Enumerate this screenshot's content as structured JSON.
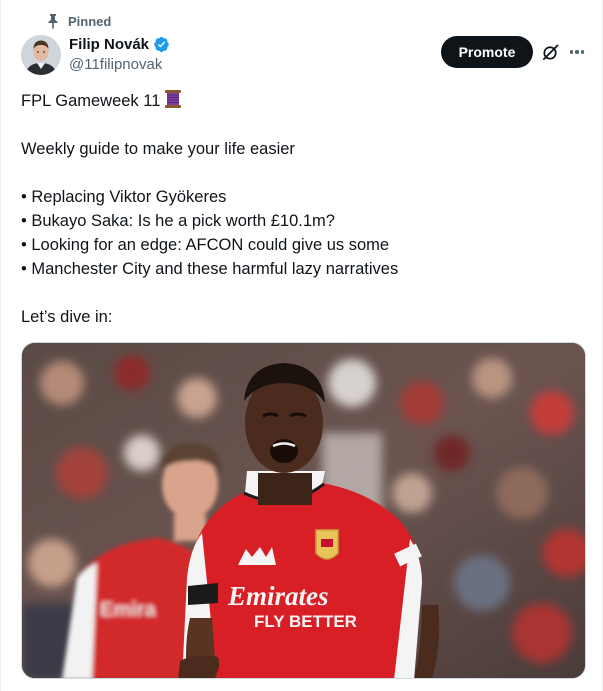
{
  "pinned_label": "Pinned",
  "author": {
    "name": "Filip Novák",
    "handle": "@11filipnovak"
  },
  "actions": {
    "promote_label": "Promote"
  },
  "tweet": {
    "title": "FPL Gameweek 11",
    "subtitle": "Weekly guide to make your life easier",
    "bullets": [
      "• Replacing Viktor Gyökeres",
      "• Bukayo Saka: Is he a pick worth £10.1m?",
      "• Looking for an edge: AFCON could give us some",
      "• Manchester City and these harmful lazy narratives"
    ],
    "closing": "Let’s dive in:"
  },
  "media": {
    "shirt_sponsor_line1": "Emirates",
    "shirt_sponsor_line2": "FLY BETTER",
    "teammate_shirt_text": "Emira"
  },
  "colors": {
    "verified": "#1d9bf0",
    "promote_bg": "#0f1419",
    "secondary_text": "#536471",
    "arsenal_red": "#d91f26"
  },
  "icons": {
    "pin": "pin-icon",
    "verified": "verified-badge-icon",
    "grok": "grok-icon",
    "more": "more-icon",
    "thread": "thread-spool-emoji"
  }
}
